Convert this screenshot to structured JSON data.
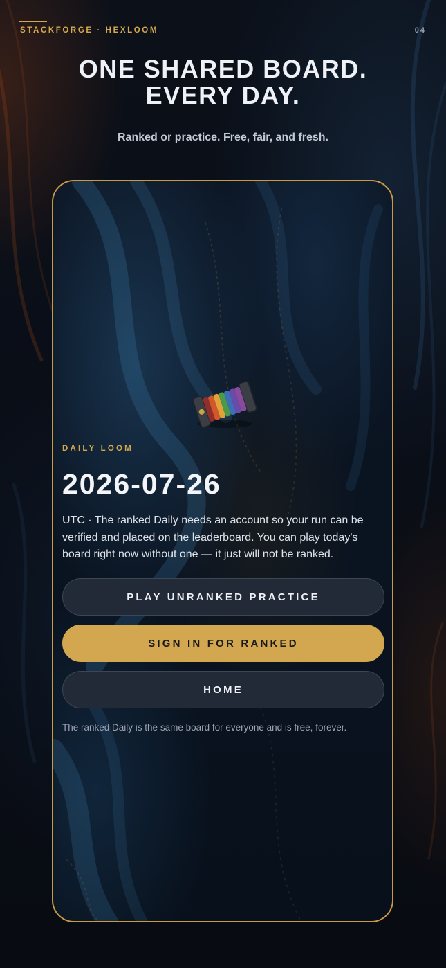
{
  "header": {
    "brand": "STACKFORGE · HEXLOOM",
    "page_number": "04"
  },
  "hero": {
    "headline_line1": "ONE SHARED BOARD.",
    "headline_line2": "EVERY DAY.",
    "subtitle": "Ranked or practice. Free, fair, and fresh."
  },
  "card": {
    "eyebrow": "DAILY LOOM",
    "date": "2026-07-26",
    "description": "UTC · The ranked Daily needs an account so your run can be verified and placed on the leaderboard. You can play today's board right now without one — it just will not be ranked.",
    "buttons": {
      "practice": "PLAY UNRANKED PRACTICE",
      "sign_in": "SIGN IN FOR RANKED",
      "home": "HOME"
    },
    "footnote": "The ranked Daily is the same board for everyone and is free, forever."
  },
  "colors": {
    "accent": "#d4a84f",
    "background": "#0a0e16",
    "button_secondary": "#222a37",
    "button_primary": "#d2a74f"
  },
  "icons": {
    "spool": "thread-spool-icon"
  }
}
